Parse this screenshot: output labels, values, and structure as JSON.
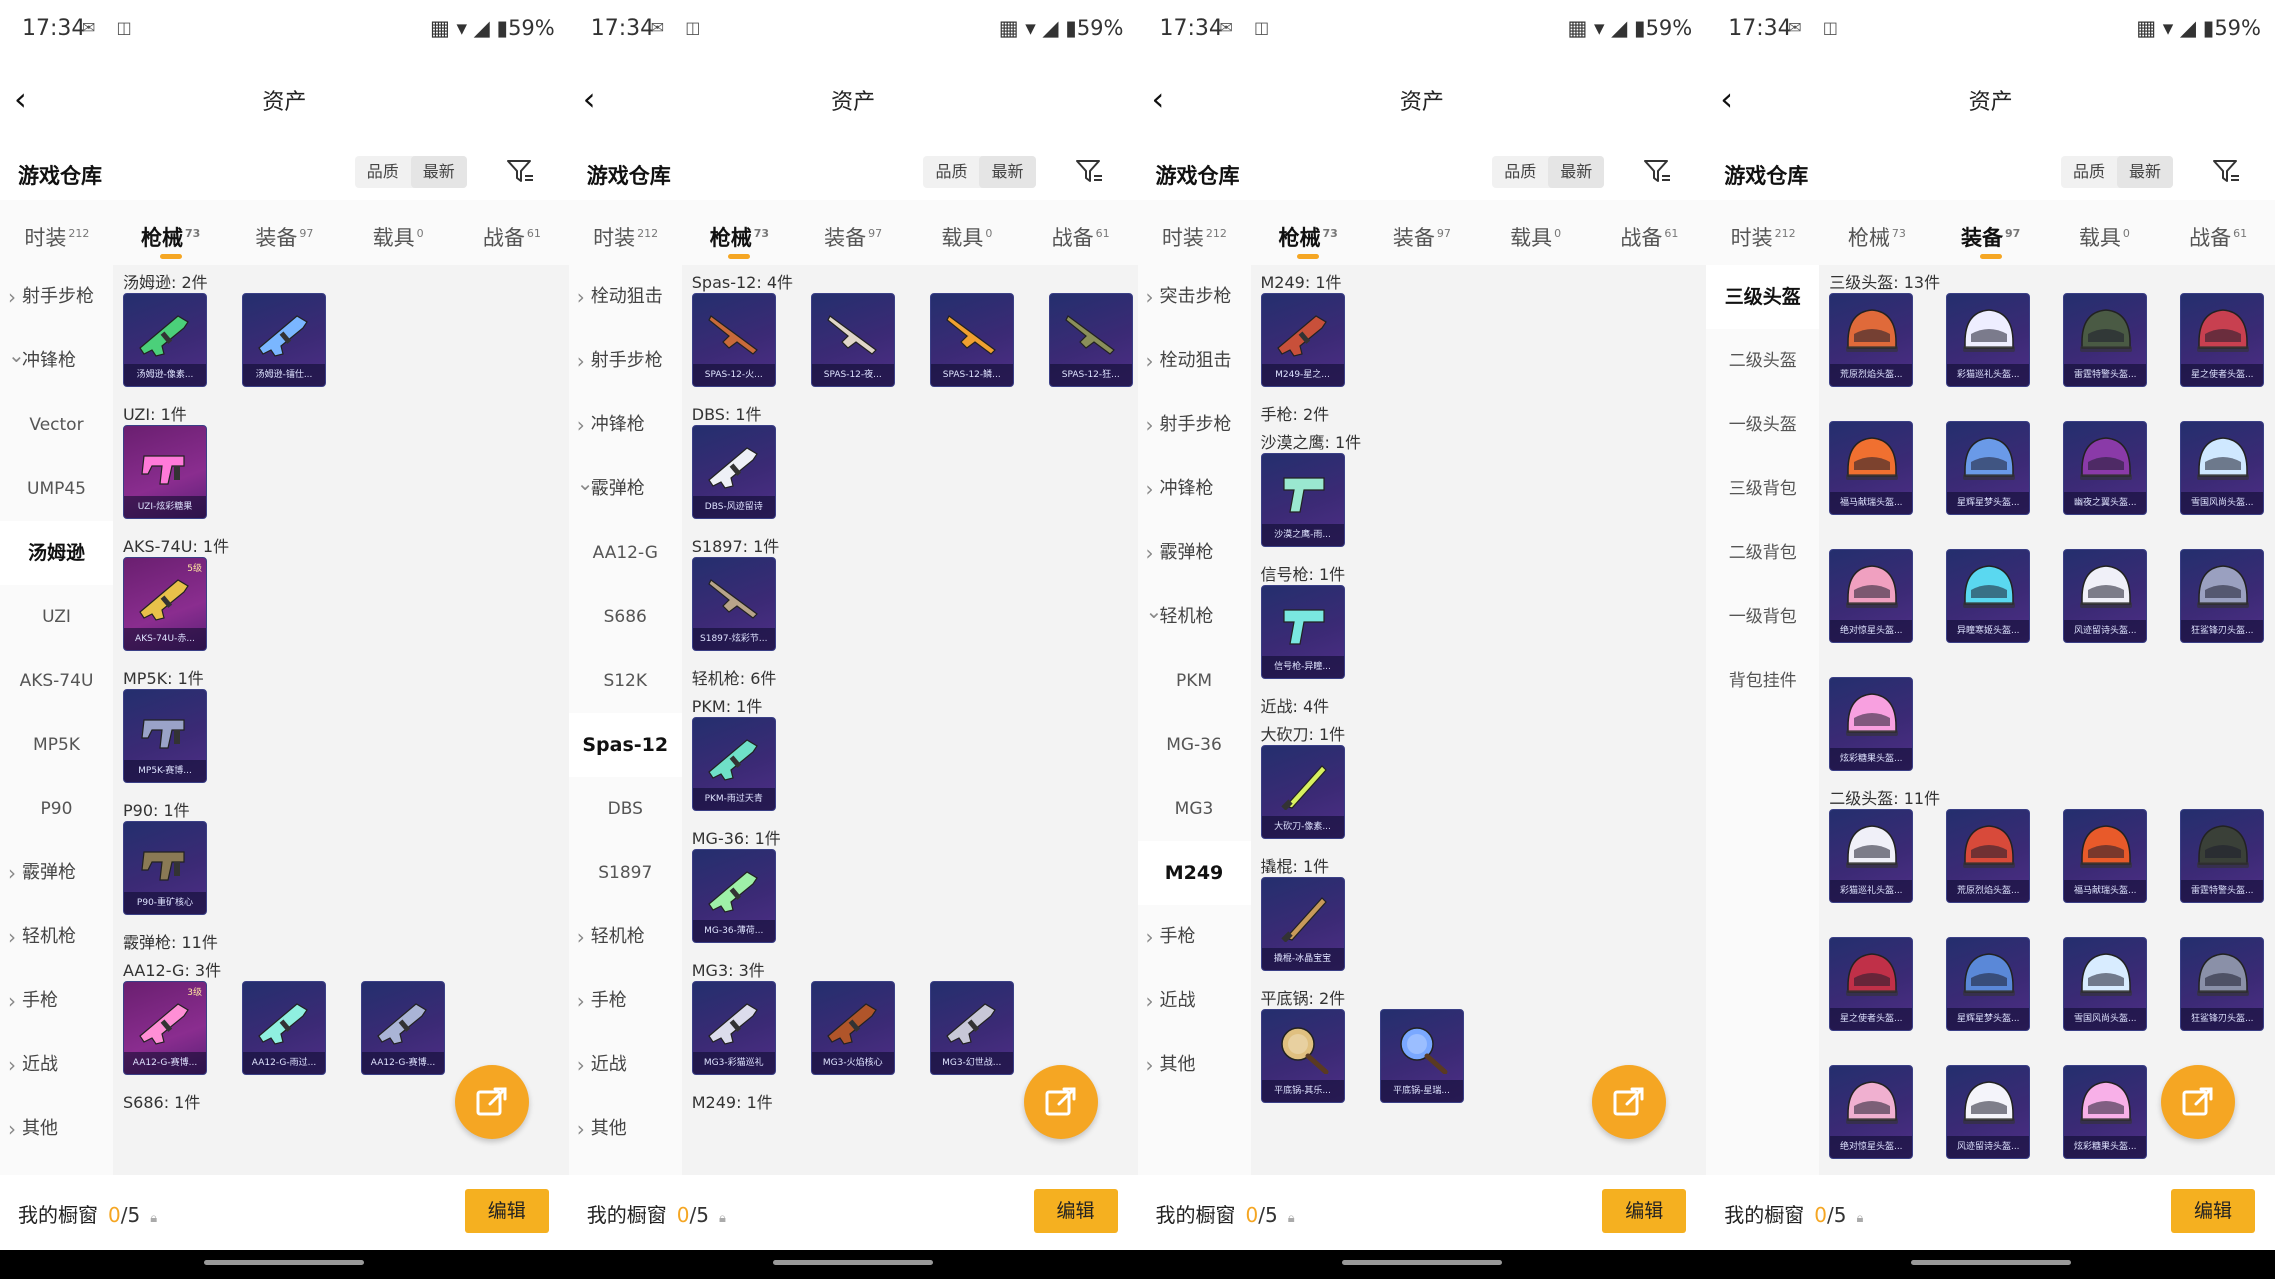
{
  "status": {
    "time": "17:34",
    "battery": "59%"
  },
  "header": {
    "title": "资产"
  },
  "toolbar": {
    "warehouse_title": "游戏仓库",
    "sort_quality": "品质",
    "sort_newest": "最新"
  },
  "tabs": [
    {
      "label": "时装",
      "count": "212"
    },
    {
      "label": "枪械",
      "count": "73"
    },
    {
      "label": "装备",
      "count": "97"
    },
    {
      "label": "载具",
      "count": "0"
    },
    {
      "label": "战备",
      "count": "61"
    }
  ],
  "footer": {
    "showcase_label": "我的橱窗",
    "showcase_count": "0",
    "showcase_total": "/5",
    "edit_label": "编辑"
  },
  "panels": [
    {
      "sidebar": [
        {
          "label": "射手步枪",
          "kind": "grp"
        },
        {
          "label": "冲锋枪",
          "kind": "grp-open"
        },
        {
          "label": "Vector",
          "kind": "sub"
        },
        {
          "label": "UMP45",
          "kind": "sub"
        },
        {
          "label": "汤姆逊",
          "kind": "sel"
        },
        {
          "label": "UZI",
          "kind": "sub"
        },
        {
          "label": "AKS-74U",
          "kind": "sub"
        },
        {
          "label": "MP5K",
          "kind": "sub"
        },
        {
          "label": "P90",
          "kind": "sub"
        },
        {
          "label": "霰弹枪",
          "kind": "grp"
        },
        {
          "label": "轻机枪",
          "kind": "grp"
        },
        {
          "label": "手枪",
          "kind": "grp"
        },
        {
          "label": "近战",
          "kind": "grp"
        },
        {
          "label": "其他",
          "kind": "grp"
        }
      ],
      "sections": [
        {
          "title": "汤姆逊: 2件",
          "items": [
            {
              "caption": "汤姆逊-像素...",
              "color": "#4bd07a",
              "icon": "gun"
            },
            {
              "caption": "汤姆逊-镭仕...",
              "color": "#7ab6ff",
              "icon": "gun"
            }
          ]
        },
        {
          "title": "UZI: 1件",
          "items": [
            {
              "caption": "UZI-炫彩糖果",
              "color": "#ff7ad9",
              "icon": "smg",
              "pink": true
            }
          ]
        },
        {
          "title": "AKS-74U: 1件",
          "items": [
            {
              "caption": "AKS-74U-赤...",
              "color": "#e8c14a",
              "icon": "gun",
              "pink": true,
              "level": "5级"
            }
          ]
        },
        {
          "title": "MP5K: 1件",
          "items": [
            {
              "caption": "MP5K-赛博...",
              "color": "#9aa3c8",
              "icon": "smg"
            }
          ]
        },
        {
          "title": "P90: 1件",
          "items": [
            {
              "caption": "P90-重矿核心",
              "color": "#8a7a55",
              "icon": "smg"
            }
          ]
        },
        {
          "title": "霰弹枪: 11件",
          "items": []
        },
        {
          "title": "AA12-G: 3件",
          "items": [
            {
              "caption": "AA12-G-赛博...",
              "color": "#ff8fd6",
              "icon": "gun",
              "pink": true,
              "level": "3级"
            },
            {
              "caption": "AA12-G-雨过...",
              "color": "#8ff0e0",
              "icon": "gun"
            },
            {
              "caption": "AA12-G-赛博...",
              "color": "#aab4d6",
              "icon": "gun"
            }
          ]
        },
        {
          "title": "S686: 1件",
          "items": []
        }
      ]
    },
    {
      "sidebar": [
        {
          "label": "栓动狙击",
          "kind": "grp"
        },
        {
          "label": "射手步枪",
          "kind": "grp"
        },
        {
          "label": "冲锋枪",
          "kind": "grp"
        },
        {
          "label": "霰弹枪",
          "kind": "grp-open"
        },
        {
          "label": "AA12-G",
          "kind": "sub"
        },
        {
          "label": "S686",
          "kind": "sub"
        },
        {
          "label": "S12K",
          "kind": "sub"
        },
        {
          "label": "Spas-12",
          "kind": "sel"
        },
        {
          "label": "DBS",
          "kind": "sub"
        },
        {
          "label": "S1897",
          "kind": "sub"
        },
        {
          "label": "轻机枪",
          "kind": "grp"
        },
        {
          "label": "手枪",
          "kind": "grp"
        },
        {
          "label": "近战",
          "kind": "grp"
        },
        {
          "label": "其他",
          "kind": "grp"
        }
      ],
      "sections": [
        {
          "title": "Spas-12: 4件",
          "items": [
            {
              "caption": "SPAS-12-火...",
              "color": "#c96a3a",
              "icon": "shotgun"
            },
            {
              "caption": "SPAS-12-夜...",
              "color": "#e0d6c8",
              "icon": "shotgun"
            },
            {
              "caption": "SPAS-12-鳞...",
              "color": "#f0a030",
              "icon": "shotgun"
            },
            {
              "caption": "SPAS-12-狂...",
              "color": "#8a8f5a",
              "icon": "shotgun"
            }
          ]
        },
        {
          "title": "DBS: 1件",
          "items": [
            {
              "caption": "DBS-风迹留诗",
              "color": "#eef0f6",
              "icon": "gun"
            }
          ]
        },
        {
          "title": "S1897: 1件",
          "items": [
            {
              "caption": "S1897-炫彩节...",
              "color": "#b8a48a",
              "icon": "shotgun"
            }
          ]
        },
        {
          "title": "轻机枪: 6件",
          "items": []
        },
        {
          "title": "PKM: 1件",
          "items": [
            {
              "caption": "PKM-雨过天青",
              "color": "#6fe0c8",
              "icon": "gun"
            }
          ]
        },
        {
          "title": "MG-36: 1件",
          "items": [
            {
              "caption": "MG-36-薄荷...",
              "color": "#9ef0a8",
              "icon": "gun"
            }
          ]
        },
        {
          "title": "MG3: 3件",
          "items": [
            {
              "caption": "MG3-彩猫巡礼",
              "color": "#dcdcec",
              "icon": "gun"
            },
            {
              "caption": "MG3-火焰核心",
              "color": "#b0552a",
              "icon": "gun"
            },
            {
              "caption": "MG3-幻世战...",
              "color": "#c8c8d8",
              "icon": "gun"
            }
          ]
        },
        {
          "title": "M249: 1件",
          "items": []
        }
      ]
    },
    {
      "sidebar": [
        {
          "label": "突击步枪",
          "kind": "grp"
        },
        {
          "label": "栓动狙击",
          "kind": "grp"
        },
        {
          "label": "射手步枪",
          "kind": "grp"
        },
        {
          "label": "冲锋枪",
          "kind": "grp"
        },
        {
          "label": "霰弹枪",
          "kind": "grp"
        },
        {
          "label": "轻机枪",
          "kind": "grp-open"
        },
        {
          "label": "PKM",
          "kind": "sub"
        },
        {
          "label": "MG-36",
          "kind": "sub"
        },
        {
          "label": "MG3",
          "kind": "sub"
        },
        {
          "label": "M249",
          "kind": "sel"
        },
        {
          "label": "手枪",
          "kind": "grp"
        },
        {
          "label": "近战",
          "kind": "grp"
        },
        {
          "label": "其他",
          "kind": "grp"
        }
      ],
      "sections": [
        {
          "title": "M249: 1件",
          "items": [
            {
              "caption": "M249-星之...",
              "color": "#c8503a",
              "icon": "gun"
            }
          ]
        },
        {
          "title": "手枪: 2件",
          "items": []
        },
        {
          "title": "沙漠之鹰: 1件",
          "items": [
            {
              "caption": "沙漠之鹰-雨...",
              "color": "#9ae8d0",
              "icon": "pistol"
            }
          ]
        },
        {
          "title": "信号枪: 1件",
          "items": [
            {
              "caption": "信号枪-异瞳...",
              "color": "#7ae8e0",
              "icon": "pistol"
            }
          ]
        },
        {
          "title": "近战: 4件",
          "items": []
        },
        {
          "title": "大砍刀: 1件",
          "items": [
            {
              "caption": "大砍刀-像素...",
              "color": "#d8f060",
              "icon": "blade"
            }
          ]
        },
        {
          "title": "撬棍: 1件",
          "items": [
            {
              "caption": "撬棍-冰晶宝宝",
              "color": "#c89a5a",
              "icon": "blade"
            }
          ]
        },
        {
          "title": "平底锅: 2件",
          "items": [
            {
              "caption": "平底锅-其乐...",
              "color": "#e0c080",
              "icon": "pan"
            },
            {
              "caption": "平底锅-星瑞...",
              "color": "#7aa8ff",
              "icon": "pan"
            }
          ]
        }
      ]
    },
    {
      "sidebar": [
        {
          "label": "三级头盔",
          "kind": "sel"
        },
        {
          "label": "二级头盔",
          "kind": "sub"
        },
        {
          "label": "一级头盔",
          "kind": "sub"
        },
        {
          "label": "三级背包",
          "kind": "sub"
        },
        {
          "label": "二级背包",
          "kind": "sub"
        },
        {
          "label": "一级背包",
          "kind": "sub"
        },
        {
          "label": "背包挂件",
          "kind": "sub"
        }
      ],
      "sections": [
        {
          "title": "三级头盔: 13件",
          "items": [
            {
              "caption": "荒原烈焰头盔...",
              "color": "#e06a3a",
              "icon": "helmet"
            },
            {
              "caption": "彩猫巡礼头盔...",
              "color": "#eeeeff",
              "icon": "helmet"
            },
            {
              "caption": "雷霆特警头盔...",
              "color": "#4a5a44",
              "icon": "helmet"
            },
            {
              "caption": "星之使者头盔...",
              "color": "#c84050",
              "icon": "helmet"
            },
            {
              "caption": "福马献瑞头盔...",
              "color": "#f07030",
              "icon": "helmet"
            },
            {
              "caption": "星辉星梦头盔...",
              "color": "#6a9ae8",
              "icon": "helmet"
            },
            {
              "caption": "幽夜之翼头盔...",
              "color": "#8a3aa8",
              "icon": "helmet"
            },
            {
              "caption": "雪国风尚头盔...",
              "color": "#cfe8ff",
              "icon": "helmet"
            },
            {
              "caption": "绝对惊星头盔...",
              "color": "#f0a0c0",
              "icon": "helmet"
            },
            {
              "caption": "异瞳寒姬头盔...",
              "color": "#5ad8f0",
              "icon": "helmet"
            },
            {
              "caption": "风迹留诗头盔...",
              "color": "#f0f0f8",
              "icon": "helmet"
            },
            {
              "caption": "狂鲨锋刃头盔...",
              "color": "#9aa0c0",
              "icon": "helmet"
            },
            {
              "caption": "炫彩糖果头盔...",
              "color": "#f8a0e0",
              "icon": "helmet"
            }
          ]
        },
        {
          "title": "二级头盔: 11件",
          "items": [
            {
              "caption": "彩猫巡礼头盔...",
              "color": "#f0f0f8",
              "icon": "helmet"
            },
            {
              "caption": "荒原烈焰头盔...",
              "color": "#d84a3a",
              "icon": "helmet"
            },
            {
              "caption": "福马献瑞头盔...",
              "color": "#e85a2a",
              "icon": "helmet"
            },
            {
              "caption": "雷霆特警头盔...",
              "color": "#3a4038",
              "icon": "helmet"
            },
            {
              "caption": "星之使者头盔...",
              "color": "#c03048",
              "icon": "helmet"
            },
            {
              "caption": "星辉星梦头盔...",
              "color": "#5a88d8",
              "icon": "helmet"
            },
            {
              "caption": "雪国风尚头盔...",
              "color": "#d8ecff",
              "icon": "helmet"
            },
            {
              "caption": "狂鲨锋刃头盔...",
              "color": "#8a90a8",
              "icon": "helmet"
            },
            {
              "caption": "绝对惊星头盔...",
              "color": "#f0b0d0",
              "icon": "helmet"
            },
            {
              "caption": "风迹留诗头盔...",
              "color": "#f4f4fa",
              "icon": "helmet"
            },
            {
              "caption": "炫彩糖果头盔...",
              "color": "#f8b0e8",
              "icon": "helmet"
            }
          ]
        }
      ]
    }
  ],
  "active_tabs": [
    1,
    1,
    1,
    2
  ],
  "icons": {
    "back": "back-arrow-icon",
    "filter": "filter-icon",
    "share": "share-icon",
    "lock": "lock-icon"
  }
}
